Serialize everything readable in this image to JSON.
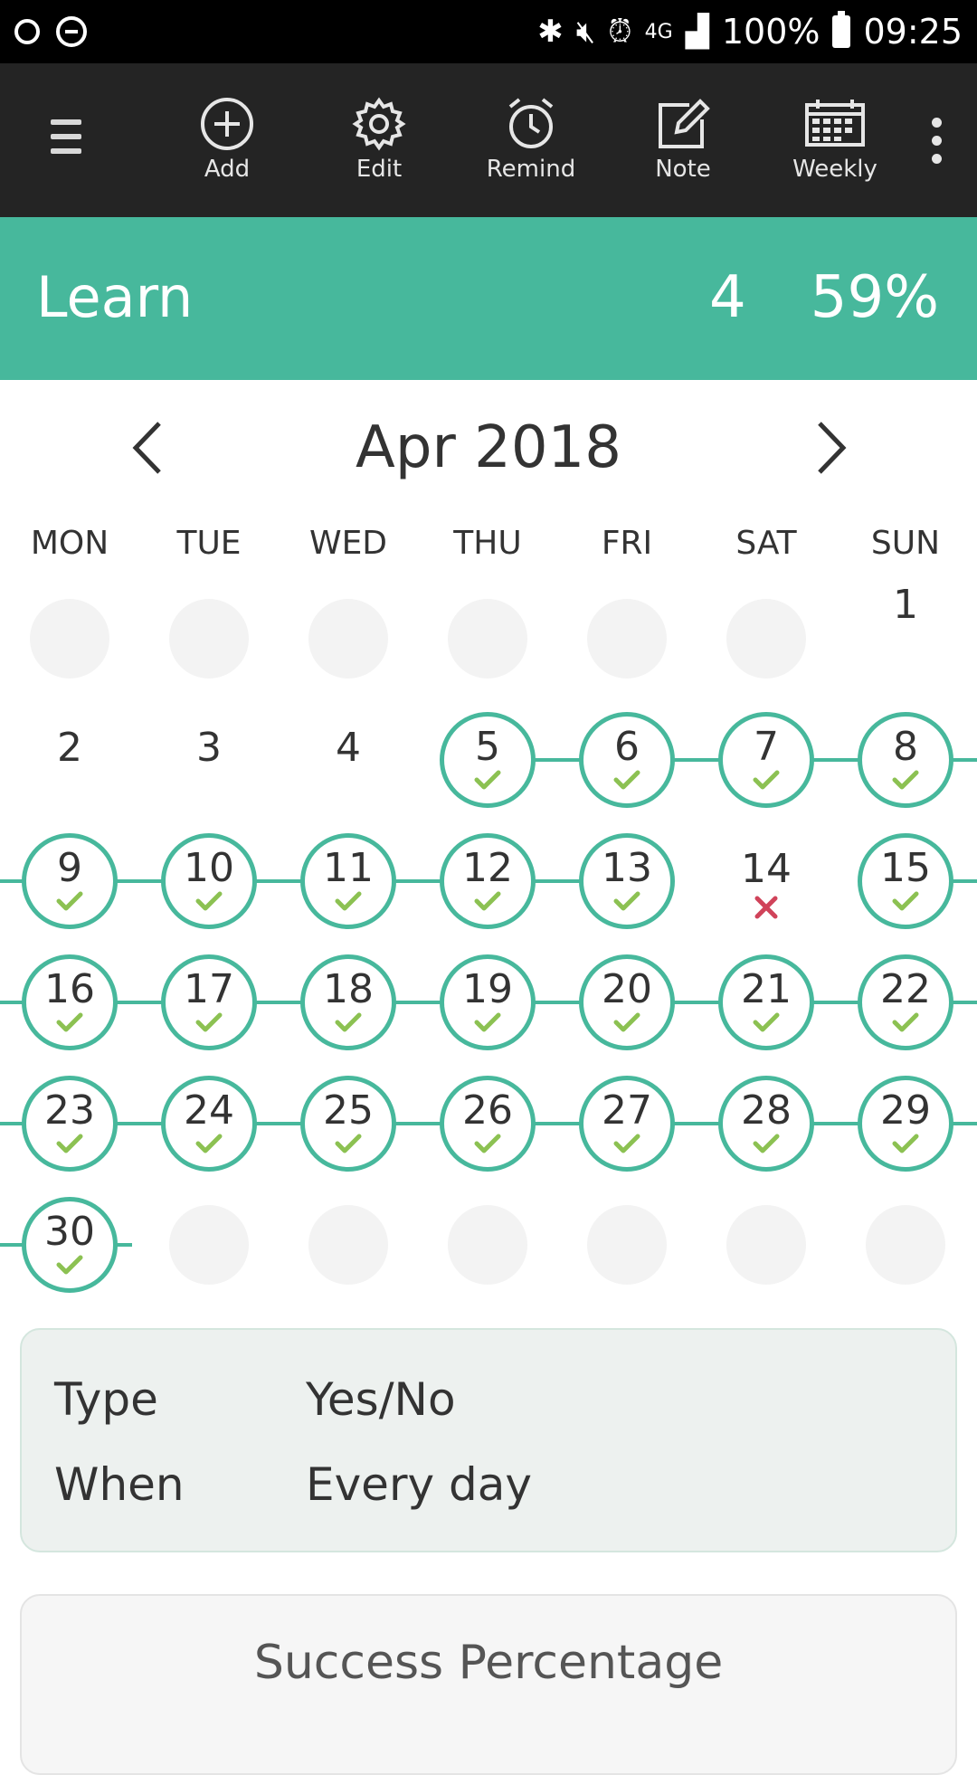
{
  "status_bar": {
    "battery": "100%",
    "time": "09:25",
    "network": "4G",
    "icons": [
      "circle-icon",
      "do-not-disturb-icon",
      "bluetooth-icon",
      "mute-icon",
      "alarm-icon",
      "signal-icon",
      "battery-icon"
    ]
  },
  "toolbar": {
    "add_label": "Add",
    "edit_label": "Edit",
    "remind_label": "Remind",
    "note_label": "Note",
    "weekly_label": "Weekly"
  },
  "habit": {
    "name": "Learn",
    "streak": "4",
    "percent": "59%",
    "accent": "#47b89c"
  },
  "calendar": {
    "month_label": "Apr 2018",
    "weekdays": [
      "MON",
      "TUE",
      "WED",
      "THU",
      "FRI",
      "SAT",
      "SUN"
    ],
    "rows": [
      [
        {
          "s": "empty"
        },
        {
          "s": "empty"
        },
        {
          "s": "empty"
        },
        {
          "s": "empty"
        },
        {
          "s": "empty"
        },
        {
          "s": "empty"
        },
        {
          "d": "1",
          "s": "plain"
        }
      ],
      [
        {
          "d": "2",
          "s": "plain"
        },
        {
          "d": "3",
          "s": "plain"
        },
        {
          "d": "4",
          "s": "plain"
        },
        {
          "d": "5",
          "s": "done"
        },
        {
          "d": "6",
          "s": "done"
        },
        {
          "d": "7",
          "s": "done"
        },
        {
          "d": "8",
          "s": "done"
        }
      ],
      [
        {
          "d": "9",
          "s": "done"
        },
        {
          "d": "10",
          "s": "done"
        },
        {
          "d": "11",
          "s": "done"
        },
        {
          "d": "12",
          "s": "done"
        },
        {
          "d": "13",
          "s": "done"
        },
        {
          "d": "14",
          "s": "miss"
        },
        {
          "d": "15",
          "s": "done"
        }
      ],
      [
        {
          "d": "16",
          "s": "done"
        },
        {
          "d": "17",
          "s": "done"
        },
        {
          "d": "18",
          "s": "done"
        },
        {
          "d": "19",
          "s": "done"
        },
        {
          "d": "20",
          "s": "done"
        },
        {
          "d": "21",
          "s": "done"
        },
        {
          "d": "22",
          "s": "done"
        }
      ],
      [
        {
          "d": "23",
          "s": "done"
        },
        {
          "d": "24",
          "s": "done"
        },
        {
          "d": "25",
          "s": "done"
        },
        {
          "d": "26",
          "s": "done"
        },
        {
          "d": "27",
          "s": "done"
        },
        {
          "d": "28",
          "s": "done"
        },
        {
          "d": "29",
          "s": "done"
        }
      ],
      [
        {
          "d": "30",
          "s": "done"
        },
        {
          "s": "empty"
        },
        {
          "s": "empty"
        },
        {
          "s": "empty"
        },
        {
          "s": "empty"
        },
        {
          "s": "empty"
        },
        {
          "s": "empty"
        }
      ]
    ],
    "check_color": "#8cc152",
    "miss_color": "#d0435a"
  },
  "info": {
    "type_label": "Type",
    "type_value": "Yes/No",
    "when_label": "When",
    "when_value": "Every day"
  },
  "success": {
    "title": "Success Percentage"
  }
}
